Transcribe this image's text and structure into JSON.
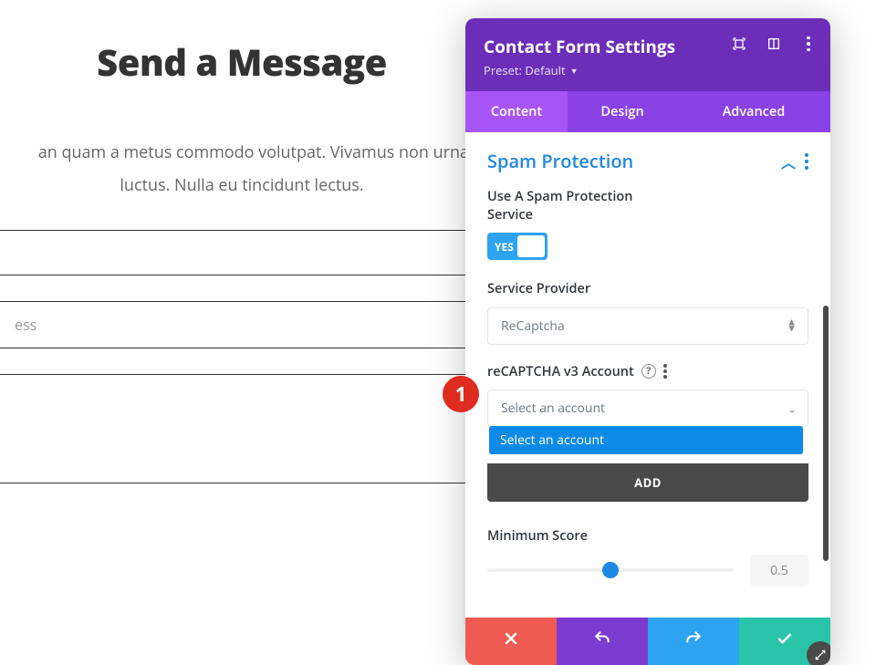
{
  "page": {
    "heading": "Send a Message",
    "intro_line1": "an quam a metus commodo volutpat. Vivamus non urna sit",
    "intro_line2": "luctus. Nulla eu tincidunt lectus.",
    "field_email_placeholder": "ess"
  },
  "marker": {
    "num": "1"
  },
  "panel": {
    "title": "Contact Form Settings",
    "preset_label": "Preset: Default",
    "tabs": {
      "content": "Content",
      "design": "Design",
      "advanced": "Advanced"
    },
    "section": {
      "title": "Spam Protection",
      "use_service_label": "Use A Spam Protection Service",
      "toggle_text": "YES",
      "provider_label": "Service Provider",
      "provider_value": "ReCaptcha",
      "account_label": "reCAPTCHA v3 Account",
      "account_placeholder": "Select an account",
      "account_option": "Select an account",
      "add_btn": "ADD",
      "min_score_label": "Minimum Score",
      "min_score_value": "0.5",
      "min_score_slider_pos_pct": 50
    },
    "footer": {}
  }
}
